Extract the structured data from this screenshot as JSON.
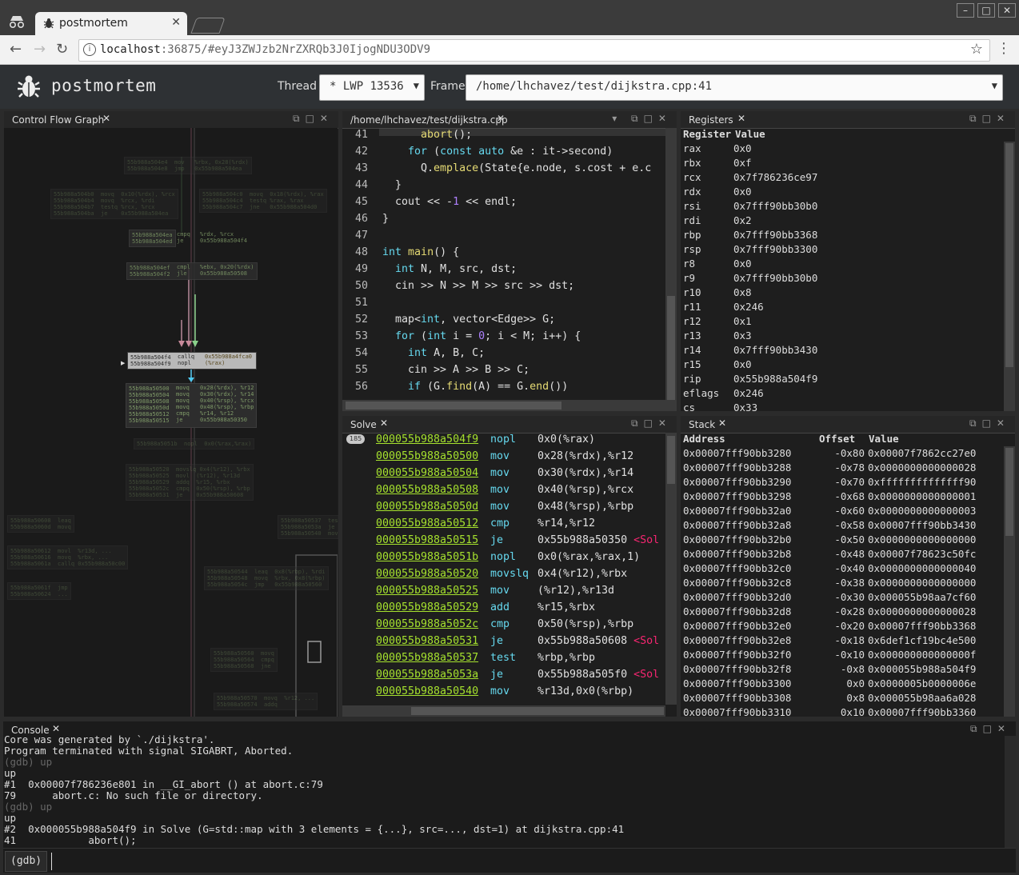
{
  "browser": {
    "tab_title": "postmortem",
    "url_host": "localhost",
    "url_rest": ":36875/#eyJ3ZWJzb2NrZXRQb3J0IjogNDU3ODV9",
    "icons": [
      "incognito-icon",
      "bug-icon",
      "back-icon",
      "forward-icon",
      "reload-icon",
      "info-icon",
      "star-icon",
      "menu-icon"
    ]
  },
  "app": {
    "title": "postmortem",
    "thread_label": "Thread",
    "thread_value": "* LWP 13536",
    "frame_label": "Frame",
    "frame_value": "/home/lhchavez/test/dijkstra.cpp:41"
  },
  "panels": {
    "cfg": "Control Flow Graph",
    "source": "/home/lhchavez/test/dijkstra.cpp",
    "registers": "Registers",
    "solve": "Solve",
    "stack": "Stack",
    "console": "Console"
  },
  "cfg_blocks": {
    "b1_addr": "55b988a504ea\n55b988a504ed",
    "b1_op": "cmpq\nje",
    "b1_arg": "%rdx, %rcx\n0x55b988a504f4",
    "b2_addr": "55b988a504ef\n55b988a504f2",
    "b2_op": "cmpl\njle",
    "b2_arg": "%ebx, 0x20(%rdx)\n0x55b988a50508",
    "b3_addr": "55b988a504f4\n55b988a504f9",
    "b3_op": "callq\nnopl",
    "b3_arg": "0x55b988a4fca0\n(%rax)",
    "b4_addr": "55b988a50500\n55b988a50504\n55b988a50508\n55b988a5050d\n55b988a50512\n55b988a50515",
    "b4_op": "movq\nmovq\nmovq\nmovq\ncmpq\nje",
    "b4_arg": "0x28(%rdx), %r12\n0x30(%rdx), %r14\n0x40(%rsp), %rcx\n0x48(%rsp), %rbp\n%r14, %r12\n0x55b988a50350"
  },
  "source": {
    "lines": [
      {
        "n": "41",
        "code": "      abort();"
      },
      {
        "n": "42",
        "code": "    for (const auto &e : it->second)"
      },
      {
        "n": "43",
        "code": "      Q.emplace(State{e.node, s.cost + e.c"
      },
      {
        "n": "44",
        "code": "  }"
      },
      {
        "n": "45",
        "code": "  cout << -1 << endl;"
      },
      {
        "n": "46",
        "code": "}"
      },
      {
        "n": "47",
        "code": ""
      },
      {
        "n": "48",
        "code": "int main() {"
      },
      {
        "n": "49",
        "code": "  int N, M, src, dst;"
      },
      {
        "n": "50",
        "code": "  cin >> N >> M >> src >> dst;"
      },
      {
        "n": "51",
        "code": ""
      },
      {
        "n": "52",
        "code": "  map<int, vector<Edge>> G;"
      },
      {
        "n": "53",
        "code": "  for (int i = 0; i < M; i++) {"
      },
      {
        "n": "54",
        "code": "    int A, B, C;"
      },
      {
        "n": "55",
        "code": "    cin >> A >> B >> C;"
      },
      {
        "n": "56",
        "code": "    if (G.find(A) == G.end())"
      }
    ]
  },
  "registers": {
    "header_name": "Register",
    "header_value": "Value",
    "rows": [
      {
        "name": "rax",
        "value": "0x0"
      },
      {
        "name": "rbx",
        "value": "0xf"
      },
      {
        "name": "rcx",
        "value": "0x7f786236ce97"
      },
      {
        "name": "rdx",
        "value": "0x0"
      },
      {
        "name": "rsi",
        "value": "0x7fff90bb30b0"
      },
      {
        "name": "rdi",
        "value": "0x2"
      },
      {
        "name": "rbp",
        "value": "0x7fff90bb3368"
      },
      {
        "name": "rsp",
        "value": "0x7fff90bb3300"
      },
      {
        "name": "r8",
        "value": "0x0"
      },
      {
        "name": "r9",
        "value": "0x7fff90bb30b0"
      },
      {
        "name": "r10",
        "value": "0x8"
      },
      {
        "name": "r11",
        "value": "0x246"
      },
      {
        "name": "r12",
        "value": "0x1"
      },
      {
        "name": "r13",
        "value": "0x3"
      },
      {
        "name": "r14",
        "value": "0x7fff90bb3430"
      },
      {
        "name": "r15",
        "value": "0x0"
      },
      {
        "name": "rip",
        "value": "0x55b988a504f9"
      },
      {
        "name": "eflags",
        "value": "0x246"
      },
      {
        "name": "cs",
        "value": "0x33"
      }
    ]
  },
  "solve": {
    "badge": "185",
    "rows": [
      {
        "addr": "000055b988a504f9",
        "op": "nopl",
        "arg": "0x0(%rax)",
        "sym": ""
      },
      {
        "addr": "000055b988a50500",
        "op": "mov",
        "arg": "0x28(%rdx),%r12",
        "sym": ""
      },
      {
        "addr": "000055b988a50504",
        "op": "mov",
        "arg": "0x30(%rdx),%r14",
        "sym": ""
      },
      {
        "addr": "000055b988a50508",
        "op": "mov",
        "arg": "0x40(%rsp),%rcx",
        "sym": ""
      },
      {
        "addr": "000055b988a5050d",
        "op": "mov",
        "arg": "0x48(%rsp),%rbp",
        "sym": ""
      },
      {
        "addr": "000055b988a50512",
        "op": "cmp",
        "arg": "%r14,%r12",
        "sym": ""
      },
      {
        "addr": "000055b988a50515",
        "op": "je",
        "arg": "0x55b988a50350 ",
        "sym": "<Sol"
      },
      {
        "addr": "000055b988a5051b",
        "op": "nopl",
        "arg": "0x0(%rax,%rax,1)",
        "sym": ""
      },
      {
        "addr": "000055b988a50520",
        "op": "movslq",
        "arg": "0x4(%r12),%rbx",
        "sym": ""
      },
      {
        "addr": "000055b988a50525",
        "op": "mov",
        "arg": "(%r12),%r13d",
        "sym": ""
      },
      {
        "addr": "000055b988a50529",
        "op": "add",
        "arg": "%r15,%rbx",
        "sym": ""
      },
      {
        "addr": "000055b988a5052c",
        "op": "cmp",
        "arg": "0x50(%rsp),%rbp",
        "sym": ""
      },
      {
        "addr": "000055b988a50531",
        "op": "je",
        "arg": "0x55b988a50608 ",
        "sym": "<Sol"
      },
      {
        "addr": "000055b988a50537",
        "op": "test",
        "arg": "%rbp,%rbp",
        "sym": ""
      },
      {
        "addr": "000055b988a5053a",
        "op": "je",
        "arg": "0x55b988a505f0 ",
        "sym": "<Sol"
      },
      {
        "addr": "000055b988a50540",
        "op": "mov",
        "arg": "%r13d,0x0(%rbp)",
        "sym": ""
      }
    ]
  },
  "stack": {
    "header_address": "Address",
    "header_offset": "Offset",
    "header_value": "Value",
    "rows": [
      {
        "addr": "0x00007fff90bb3280",
        "off": "-0x80",
        "val": "0x00007f7862cc27e0"
      },
      {
        "addr": "0x00007fff90bb3288",
        "off": "-0x78",
        "val": "0x0000000000000028"
      },
      {
        "addr": "0x00007fff90bb3290",
        "off": "-0x70",
        "val": "0xffffffffffffff90"
      },
      {
        "addr": "0x00007fff90bb3298",
        "off": "-0x68",
        "val": "0x0000000000000001"
      },
      {
        "addr": "0x00007fff90bb32a0",
        "off": "-0x60",
        "val": "0x0000000000000003"
      },
      {
        "addr": "0x00007fff90bb32a8",
        "off": "-0x58",
        "val": "0x00007fff90bb3430"
      },
      {
        "addr": "0x00007fff90bb32b0",
        "off": "-0x50",
        "val": "0x0000000000000000"
      },
      {
        "addr": "0x00007fff90bb32b8",
        "off": "-0x48",
        "val": "0x00007f78623c50fc"
      },
      {
        "addr": "0x00007fff90bb32c0",
        "off": "-0x40",
        "val": "0x0000000000000040"
      },
      {
        "addr": "0x00007fff90bb32c8",
        "off": "-0x38",
        "val": "0x0000000000000000"
      },
      {
        "addr": "0x00007fff90bb32d0",
        "off": "-0x30",
        "val": "0x000055b98aa7cf60"
      },
      {
        "addr": "0x00007fff90bb32d8",
        "off": "-0x28",
        "val": "0x0000000000000028"
      },
      {
        "addr": "0x00007fff90bb32e0",
        "off": "-0x20",
        "val": "0x00007fff90bb3368"
      },
      {
        "addr": "0x00007fff90bb32e8",
        "off": "-0x18",
        "val": "0x6def1cf19bc4e500"
      },
      {
        "addr": "0x00007fff90bb32f0",
        "off": "-0x10",
        "val": "0x000000000000000f"
      },
      {
        "addr": "0x00007fff90bb32f8",
        "off": "-0x8",
        "val": "0x000055b988a504f9"
      },
      {
        "addr": "0x00007fff90bb3300",
        "off": "0x0",
        "val": "0x0000005b0000006e"
      },
      {
        "addr": "0x00007fff90bb3308",
        "off": "0x8",
        "val": "0x000055b98aa6a028"
      },
      {
        "addr": "0x00007fff90bb3310",
        "off": "0x10",
        "val": "0x00007fff90bb3360"
      }
    ]
  },
  "console": {
    "lines": [
      {
        "text": "Core was generated by `./dijkstra'.",
        "dim": false
      },
      {
        "text": "Program terminated with signal SIGABRT, Aborted.",
        "dim": false
      },
      {
        "text": "(gdb) up",
        "dim": true
      },
      {
        "text": "up",
        "dim": false
      },
      {
        "text": "#1  0x00007f786236e801 in __GI_abort () at abort.c:79",
        "dim": false
      },
      {
        "text": "79      abort.c: No such file or directory.",
        "dim": false
      },
      {
        "text": "(gdb) up",
        "dim": true
      },
      {
        "text": "up",
        "dim": false
      },
      {
        "text": "#2  0x000055b988a504f9 in Solve (G=std::map with 3 elements = {...}, src=..., dst=1) at dijkstra.cpp:41",
        "dim": false
      },
      {
        "text": "41            abort();",
        "dim": false
      }
    ],
    "prompt": "(gdb)",
    "input_value": ""
  }
}
